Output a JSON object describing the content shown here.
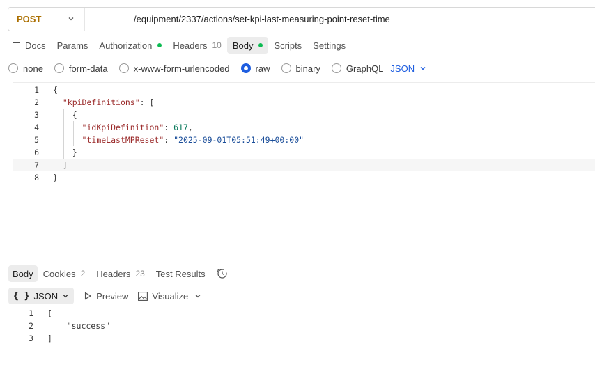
{
  "request": {
    "method": "POST",
    "url": "/equipment/2337/actions/set-kpi-last-measuring-point-reset-time"
  },
  "request_tabs": [
    {
      "label": "Docs"
    },
    {
      "label": "Params"
    },
    {
      "label": "Authorization"
    },
    {
      "label": "Headers",
      "count": "10"
    },
    {
      "label": "Body"
    },
    {
      "label": "Scripts"
    },
    {
      "label": "Settings"
    }
  ],
  "body_types": [
    {
      "label": "none",
      "selected": false
    },
    {
      "label": "form-data",
      "selected": false
    },
    {
      "label": "x-www-form-urlencoded",
      "selected": false
    },
    {
      "label": "raw",
      "selected": true
    },
    {
      "label": "binary",
      "selected": false
    },
    {
      "label": "GraphQL",
      "selected": false
    }
  ],
  "raw_format": "JSON",
  "editor": {
    "lines": [
      {
        "n": "1",
        "t1": "{",
        "k": "",
        "t2": "",
        "v": "",
        "t3": ""
      },
      {
        "n": "2",
        "t1": "  ",
        "k": "\"kpiDefinitions\"",
        "t2": ": [",
        "v": "",
        "t3": ""
      },
      {
        "n": "3",
        "t1": "    {",
        "k": "",
        "t2": "",
        "v": "",
        "t3": ""
      },
      {
        "n": "4",
        "t1": "      ",
        "k": "\"idKpiDefinition\"",
        "t2": ": ",
        "v": "617",
        "t3": ","
      },
      {
        "n": "5",
        "t1": "      ",
        "k": "\"timeLastMPReset\"",
        "t2": ": ",
        "v": "\"2025-09-01T05:51:49+00:00\"",
        "t3": ""
      },
      {
        "n": "6",
        "t1": "    }",
        "k": "",
        "t2": "",
        "v": "",
        "t3": ""
      },
      {
        "n": "7",
        "t1": "  ]",
        "k": "",
        "t2": "",
        "v": "",
        "t3": ""
      },
      {
        "n": "8",
        "t1": "}",
        "k": "",
        "t2": "",
        "v": "",
        "t3": ""
      }
    ]
  },
  "response_tabs": [
    {
      "label": "Body"
    },
    {
      "label": "Cookies",
      "count": "2"
    },
    {
      "label": "Headers",
      "count": "23"
    },
    {
      "label": "Test Results"
    }
  ],
  "response_toolbar": {
    "format": "JSON",
    "braces": "{ }",
    "preview": "Preview",
    "visualize": "Visualize"
  },
  "response_lines": [
    {
      "n": "1",
      "text": "["
    },
    {
      "n": "2",
      "text": "    \"success\""
    },
    {
      "n": "3",
      "text": "]"
    }
  ],
  "colors": {
    "method": "#ab6f00",
    "accent": "#1f5ee0",
    "status_dot": "#0cbb52",
    "json_key": "#9b2b2b",
    "json_number": "#0a7a5c",
    "json_string": "#1a4d99"
  },
  "icons": {
    "method_dropdown": "chevron-down-icon",
    "docs": "docs-lines-icon",
    "format_dropdown": "chevron-down-icon",
    "history": "history-clock-icon",
    "preview": "play-triangle-icon",
    "visualize": "image-icon"
  }
}
